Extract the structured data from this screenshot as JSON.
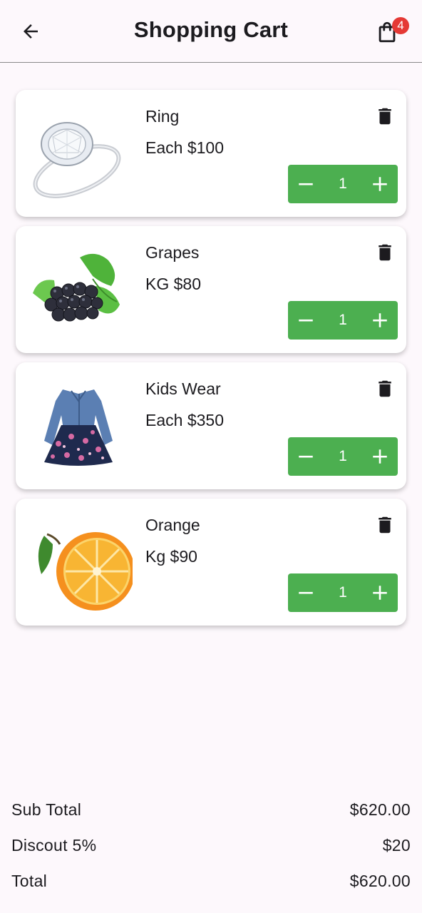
{
  "header": {
    "title": "Shopping Cart",
    "back_icon": "arrow-left-icon",
    "cart_icon": "shopping-bag-icon",
    "cart_count": "4",
    "badge_color": "#e53935"
  },
  "items": [
    {
      "name": "Ring",
      "price": "Each $100",
      "quantity": "1",
      "image": "ring"
    },
    {
      "name": "Grapes",
      "price": "KG $80",
      "quantity": "1",
      "image": "grapes"
    },
    {
      "name": "Kids Wear",
      "price": "Each $350",
      "quantity": "1",
      "image": "kids-dress"
    },
    {
      "name": "Orange",
      "price": "Kg $90",
      "quantity": "1",
      "image": "orange"
    }
  ],
  "stepper": {
    "color": "#4caf50",
    "minus_icon": "minus-icon",
    "plus_icon": "plus-icon"
  },
  "delete_icon": "trash-icon",
  "summary": {
    "subtotal_label": "Sub Total",
    "subtotal_value": "$620.00",
    "discount_label": "Discout 5%",
    "discount_value": "$20",
    "total_label": "Total",
    "total_value": "$620.00"
  }
}
